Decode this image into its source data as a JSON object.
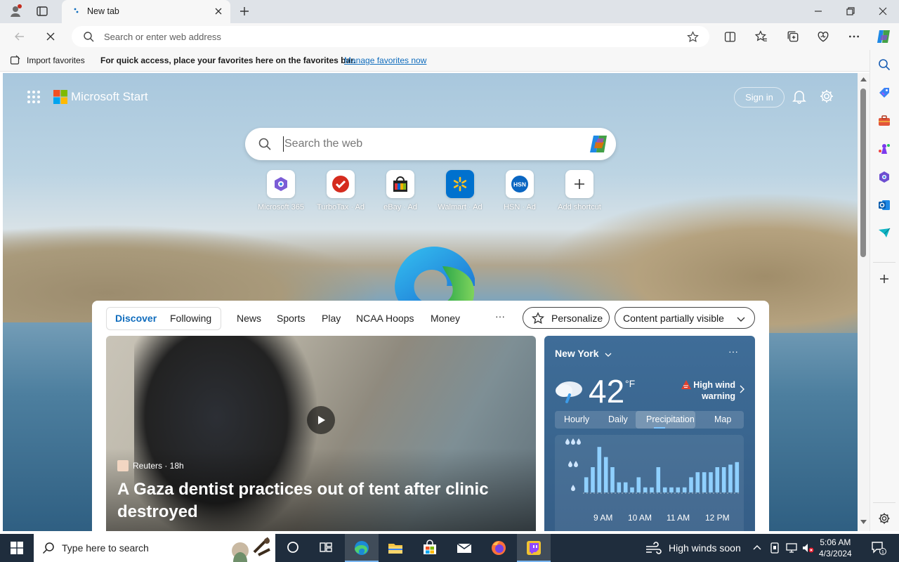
{
  "browser": {
    "tab_title": "New tab",
    "address_placeholder": "Search or enter web address"
  },
  "favorites_bar": {
    "import_label": "Import favorites",
    "message": "For quick access, place your favorites here on the favorites bar.",
    "manage_link": "Manage favorites now"
  },
  "start": {
    "brand": "Microsoft Start",
    "sign_in": "Sign in",
    "search_placeholder": "Search the web",
    "shortcuts": [
      {
        "label": "Microsoft 365"
      },
      {
        "label": "TurboTax · Ad"
      },
      {
        "label": "eBay · Ad"
      },
      {
        "label": "Walmart · Ad"
      },
      {
        "label": "HSN · Ad"
      },
      {
        "label": "Add shortcut"
      }
    ]
  },
  "feed": {
    "tabs": [
      "Discover",
      "Following"
    ],
    "nav": [
      "News",
      "Sports",
      "Play",
      "NCAA Hoops",
      "Money"
    ],
    "more": "···",
    "personalize": "Personalize",
    "content_visibility": "Content partially visible",
    "hero": {
      "source": "Reuters · 18h",
      "headline": "A Gaza dentist practices out of tent after clinic destroyed"
    }
  },
  "weather": {
    "city": "New York",
    "temp": "42",
    "unit": "°F",
    "warning_line1": "High wind",
    "warning_line2": "warning",
    "tabs": [
      "Hourly",
      "Daily",
      "Precipitation",
      "Map"
    ],
    "selected_tab": "Precipitation",
    "chart_times": [
      "9 AM",
      "10 AM",
      "11 AM",
      "12 PM"
    ],
    "precip_levels": [
      0.3,
      0.5,
      0.9,
      0.7,
      0.5,
      0.2,
      0.2,
      0.1,
      0.3,
      0.1,
      0.1,
      0.5,
      0.1,
      0.1,
      0.1,
      0.1,
      0.3,
      0.4,
      0.4,
      0.4,
      0.5,
      0.5,
      0.55,
      0.6
    ]
  },
  "taskbar": {
    "search_placeholder": "Type here to search",
    "weather_text": "High winds soon",
    "time": "5:06 AM",
    "date": "4/3/2024"
  },
  "colors": {
    "accent": "#0f6cbd",
    "taskbar": "#1f2d3d"
  }
}
